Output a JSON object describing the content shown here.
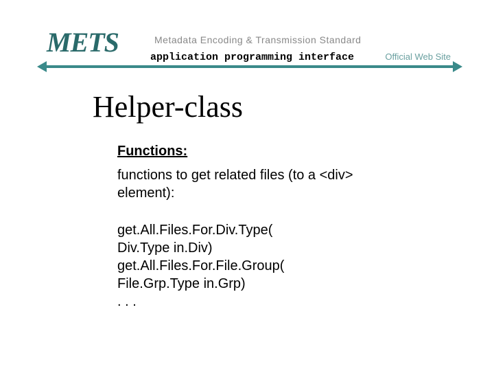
{
  "header": {
    "logo_text": "METS",
    "logo_subtitle": "Metadata Encoding & Transmission Standard",
    "api_label": "application programming interface",
    "site_label": "Official Web Site"
  },
  "main": {
    "title": "Helper-class",
    "section_label": "Functions:",
    "description": "functions to get related files (to a <div> element):",
    "code_lines": [
      "get.All.Files.For.Div.Type(",
      "Div.Type in.Div)",
      "get.All.Files.For.File.Group(",
      "File.Grp.Type in.Grp)",
      ". . ."
    ]
  }
}
